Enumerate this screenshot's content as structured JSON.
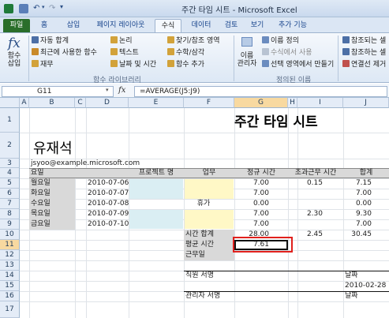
{
  "window": {
    "title": "주간 타임 시트 - Microsoft Excel"
  },
  "ribbon_tabs": [
    "파일",
    "홈",
    "삽입",
    "페이지 레이아웃",
    "수식",
    "데이터",
    "검토",
    "보기",
    "추가 기능"
  ],
  "ribbon": {
    "insert_function": "함수\n삽입",
    "autosum": "자동 합계",
    "recent": "최근에 사용한 함수",
    "finance": "재무",
    "logical": "논리",
    "text": "텍스트",
    "datetime": "날짜 및 시간",
    "lookup": "찾기/참조 영역",
    "math": "수학/삼각",
    "more": "함수 추가",
    "group_library": "함수 라이브러리",
    "name_manager": "이름\n관리자",
    "define_name": "이름 정의",
    "use_in_formula": "수식에서 사용",
    "create_from_sel": "선택 영역에서 만들기",
    "group_names": "정의된 이름",
    "trace_precedents": "참조되는 셀",
    "trace_dependents": "참조하는 셀",
    "remove_arrows": "연결선 제거"
  },
  "formula_bar": {
    "cell_ref": "G11",
    "fx": "fx",
    "formula": "=AVERAGE(J5:J9)"
  },
  "columns": [
    "A",
    "B",
    "C",
    "D",
    "E",
    "F",
    "G",
    "H",
    "I",
    "J"
  ],
  "rows": [
    "1",
    "2",
    "3",
    "4",
    "5",
    "6",
    "7",
    "8",
    "9",
    "10",
    "11",
    "12",
    "13",
    "14",
    "15",
    "16",
    "17"
  ],
  "sheet": {
    "title": "주간 타임 시트",
    "name": "유재석",
    "email": "jsyoo@example.microsoft.com",
    "headers": {
      "day": "요일",
      "project": "프로젝트 명",
      "task": "업무",
      "regular": "정규 시간",
      "overtime": "초과근무 시간",
      "total": "합계"
    },
    "data_rows": [
      {
        "day": "월요일",
        "date": "2010-07-06",
        "project": "",
        "task": "",
        "regular": "7.00",
        "overtime": "0.15",
        "total": "7.15"
      },
      {
        "day": "화요일",
        "date": "2010-07-07",
        "project": "",
        "task": "",
        "regular": "7.00",
        "overtime": "",
        "total": "7.00"
      },
      {
        "day": "수요일",
        "date": "2010-07-08",
        "project": "휴가",
        "task": "",
        "regular": "0.00",
        "overtime": "",
        "total": "0.00"
      },
      {
        "day": "목요일",
        "date": "2010-07-09",
        "project": "",
        "task": "",
        "regular": "7.00",
        "overtime": "2.30",
        "total": "9.30"
      },
      {
        "day": "금요일",
        "date": "2010-07-10",
        "project": "",
        "task": "",
        "regular": "7.00",
        "overtime": "",
        "total": "7.00"
      }
    ],
    "total_label": "시간 합계",
    "total_regular": "28.00",
    "total_overtime": "2.45",
    "total_sum": "30.45",
    "avg_label": "평균 시간",
    "avg_value": "7.61",
    "workdays_label": "근무일",
    "employee_sign": "직원 서명",
    "date_label": "날짜",
    "sign_date": "2010-02-28",
    "manager_sign": "관리자 서명",
    "date_label2": "날짜"
  },
  "colors": {
    "file_tab": "#2a6e2a",
    "selection_red": "#e0201c",
    "header_fill": "#d9d9d9",
    "project_fill": "#daeef3",
    "task_fill": "#fff8c6"
  }
}
